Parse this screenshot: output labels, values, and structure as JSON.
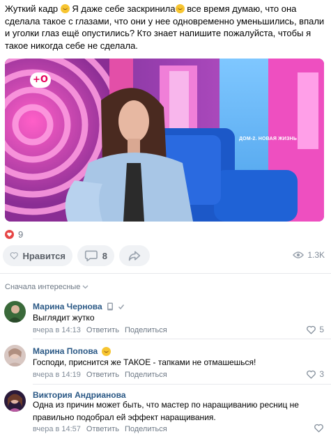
{
  "post": {
    "text_parts": [
      "Жуткий кадр ",
      " Я даже себе заскринила",
      " все время думаю, что она сделала такое с глазами, что они у нее одновременно уменьшились, впали и уголки глаз ещё опустились? Кто знает напишите пожалуйста, чтобы я такое никогда себе не сделала."
    ],
    "emoji_1": "smiling-face-emoji",
    "emoji_2": "laughing-face-emoji"
  },
  "media": {
    "logo": "+O",
    "caption": "ДОМ-2. НОВАЯ ЖИЗНЬ"
  },
  "reactions": {
    "heart_icon": "heart-icon",
    "count": "9"
  },
  "actions": {
    "like_label": "Нравится",
    "comments_count": "8",
    "share_icon": "share-icon",
    "views": "1.3K"
  },
  "comments_sort": {
    "label": "Сначала интересные"
  },
  "comments": [
    {
      "author": "Марина Чернова",
      "text": "Выглядит жутко",
      "time": "вчера в 14:13",
      "reply": "Ответить",
      "share": "Поделиться",
      "likes": "5"
    },
    {
      "author": "Марина Попова",
      "text": "Господи, приснится же ТАКОЕ - тапками не отмашешься!",
      "time": "вчера в 14:19",
      "reply": "Ответить",
      "share": "Поделиться",
      "likes": "3"
    },
    {
      "author": "Виктория Андрианова",
      "text": "Одна из причин может быть, что мастер по наращиванию ресниц не правильно подобрал ей эффект наращивания.",
      "time": "вчера в 14:57",
      "reply": "Ответить",
      "share": "Поделиться",
      "likes": ""
    }
  ],
  "colors": {
    "link": "#2a5885",
    "secondary": "#818c99",
    "pill_bg": "#f0f2f5",
    "heart_red": "#e64646"
  }
}
